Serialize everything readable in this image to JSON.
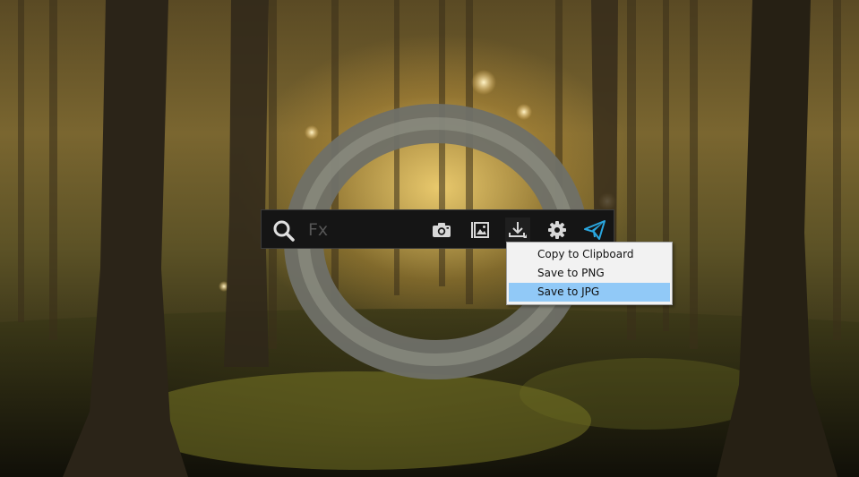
{
  "search": {
    "placeholder": "Fx",
    "value": ""
  },
  "toolbar": {
    "buttons": [
      {
        "icon": "camera-icon"
      },
      {
        "icon": "gallery-icon"
      },
      {
        "icon": "download-icon"
      },
      {
        "icon": "gear-icon"
      },
      {
        "icon": "send-icon"
      }
    ]
  },
  "menu": {
    "items": [
      {
        "label": "Copy to Clipboard"
      },
      {
        "label": "Save to PNG"
      },
      {
        "label": "Save to JPG"
      }
    ],
    "selected_label": "Save to JPG"
  },
  "colors": {
    "toolbar_bg": "#151515",
    "icon": "#d8d8d8",
    "accent": "#2aa7e0",
    "menu_bg": "#f2f2f2",
    "menu_highlight": "#91c9f7"
  }
}
